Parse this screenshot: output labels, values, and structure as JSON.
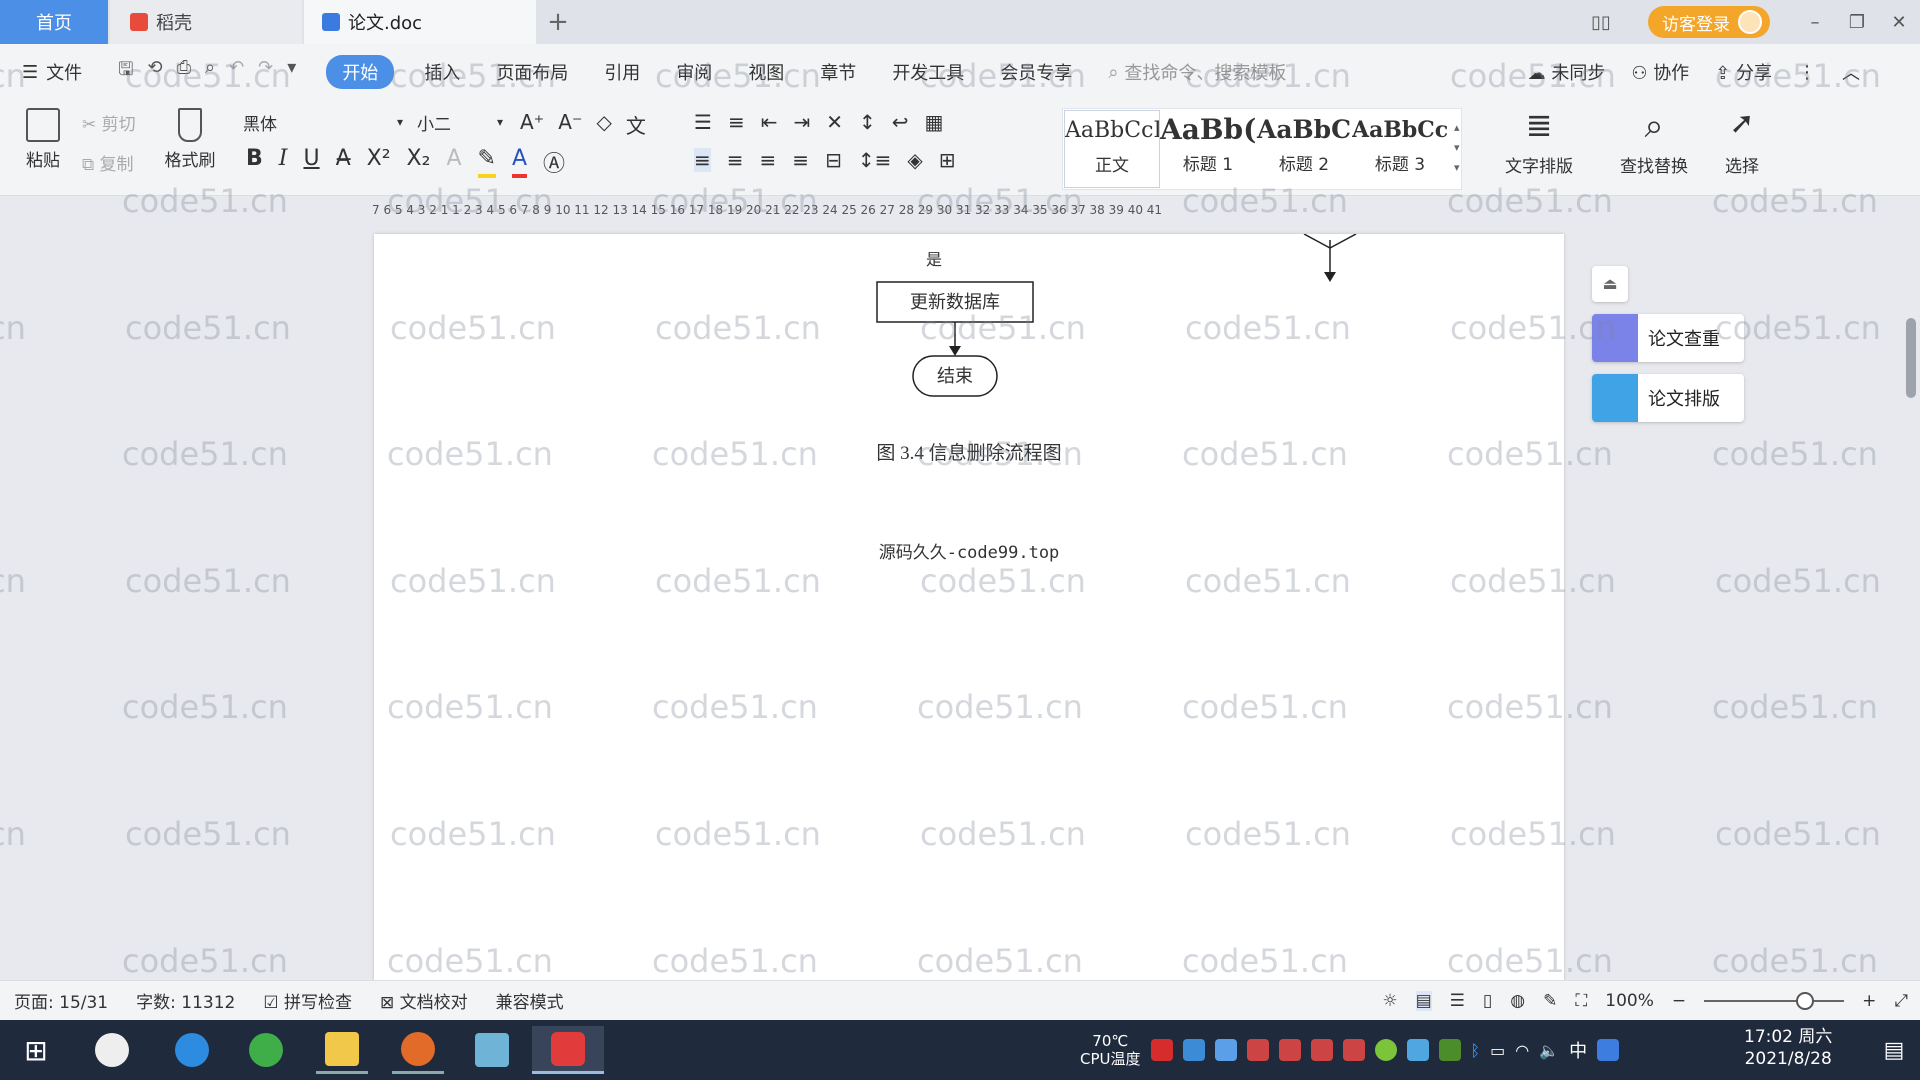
{
  "tabs": {
    "home": "首页",
    "daoke": "稻壳",
    "document": "论文.doc",
    "plus": "+"
  },
  "titlebar": {
    "login": "访客登录",
    "minimize": "–",
    "restore": "❐",
    "close": "✕"
  },
  "menu": {
    "file": "文件",
    "items": [
      "开始",
      "插入",
      "页面布局",
      "引用",
      "审阅",
      "视图",
      "章节",
      "开发工具",
      "会员专享"
    ],
    "search_placeholder": "查找命令、搜索模板",
    "unsynced": "未同步",
    "collaborate": "协作",
    "share": "分享"
  },
  "ribbon": {
    "paste": "粘贴",
    "cut": "剪切",
    "copy": "复制",
    "format_painter": "格式刷",
    "font_name": "黑体",
    "font_size": "小二",
    "styles": [
      {
        "sample": "AaBbCcI",
        "name": "正文"
      },
      {
        "sample": "AaBb(",
        "name": "标题 1"
      },
      {
        "sample": "AaBbC",
        "name": "标题 2"
      },
      {
        "sample": "AaBbCcl",
        "name": "标题 3"
      }
    ],
    "text_layout": "文字排版",
    "find_replace": "查找替换",
    "select": "选择"
  },
  "ruler": "7  6  5  4  3  2  1      1  2  3  4  5  6  7  8  9  10  11  12  13  14  15  16  17  18  19  20  21  22  23  24  25  26  27  28  29  30  31  32  33  34  35  36  37  38  39  40  41",
  "document": {
    "yes_label": "是",
    "update_box": "更新数据库",
    "end_box": "结束",
    "caption": "图 3.4  信息删除流程图",
    "source_line": "源码久久-code99.top"
  },
  "side_panel": {
    "check": "论文查重",
    "layout": "论文排版"
  },
  "statusbar": {
    "page": "页面: 15/31",
    "words": "字数: 11312",
    "spell": "拼写检查",
    "proof": "文档校对",
    "compat": "兼容模式",
    "zoom": "100%"
  },
  "taskbar": {
    "temp": "70℃",
    "cpu_label": "CPU温度",
    "ime": "中",
    "time": "17:02 周六",
    "date": "2021/8/28"
  },
  "watermark": "code51.cn",
  "colors": {
    "accent": "#4c8fe6",
    "login": "#f4a62a",
    "taskbar": "#1f2a3c"
  }
}
